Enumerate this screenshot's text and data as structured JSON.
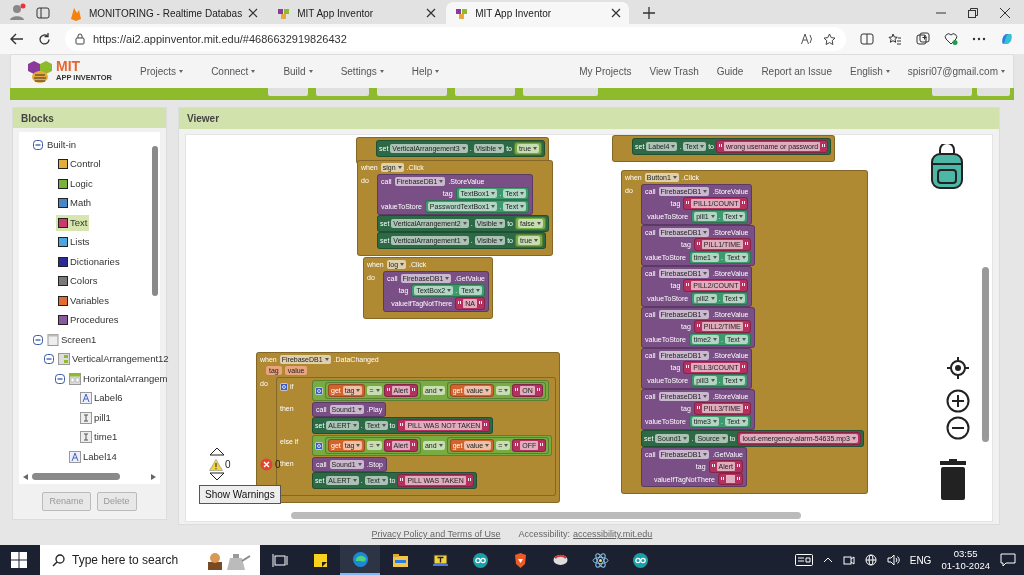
{
  "browser": {
    "tabs": [
      {
        "title": "MONITORING - Realtime Databas",
        "kind": "firebase",
        "selected": false
      },
      {
        "title": "MIT App Inventor",
        "kind": "appinventor",
        "selected": false
      },
      {
        "title": "MIT App Inventor",
        "kind": "appinventor",
        "selected": true
      }
    ],
    "url": "https://ai2.appinventor.mit.edu/#4686632919826432"
  },
  "app_header": {
    "logo_title": "MIT",
    "logo_subtitle": "APP INVENTOR",
    "menus": [
      {
        "label": "Projects",
        "dropdown": true
      },
      {
        "label": "Connect",
        "dropdown": true
      },
      {
        "label": "Build",
        "dropdown": true
      },
      {
        "label": "Settings",
        "dropdown": true
      },
      {
        "label": "Help",
        "dropdown": true
      }
    ],
    "right_links": [
      {
        "label": "My Projects",
        "dropdown": false
      },
      {
        "label": "View Trash",
        "dropdown": false
      },
      {
        "label": "Guide",
        "dropdown": false
      },
      {
        "label": "Report an Issue",
        "dropdown": false
      },
      {
        "label": "English",
        "dropdown": true
      },
      {
        "label": "spisri07@gmail.com",
        "dropdown": true
      }
    ]
  },
  "blocks_panel": {
    "title": "Blocks",
    "tree": [
      {
        "label": "Built-in",
        "kind": "folder",
        "expanded": true,
        "selected": false,
        "children": [
          {
            "label": "Control",
            "kind": "category",
            "color": "#e3ad3c",
            "selected": false
          },
          {
            "label": "Logic",
            "kind": "category",
            "color": "#7ab23d",
            "selected": false
          },
          {
            "label": "Math",
            "kind": "category",
            "color": "#4a85c4",
            "selected": false
          },
          {
            "label": "Text",
            "kind": "category",
            "color": "#c83a6b",
            "selected": true
          },
          {
            "label": "Lists",
            "kind": "category",
            "color": "#4aa6df",
            "selected": false
          },
          {
            "label": "Dictionaries",
            "kind": "category",
            "color": "#2b2a96",
            "selected": false
          },
          {
            "label": "Colors",
            "kind": "category",
            "color": "#7a7a7a",
            "selected": false
          },
          {
            "label": "Variables",
            "kind": "category",
            "color": "#e56c2f",
            "selected": false
          },
          {
            "label": "Procedures",
            "kind": "category",
            "color": "#8b5a9b",
            "selected": false
          }
        ]
      },
      {
        "label": "Screen1",
        "kind": "screen",
        "expanded": true,
        "selected": false,
        "children": [
          {
            "label": "VerticalArrangement12",
            "kind": "vertical",
            "expanded": true,
            "selected": false,
            "children": [
              {
                "label": "HorizontalArrangem",
                "kind": "horizontal",
                "expanded": true,
                "selected": false,
                "children": [
                  {
                    "label": "Label6",
                    "kind": "label",
                    "selected": false
                  },
                  {
                    "label": "pill1",
                    "kind": "textbox",
                    "selected": false
                  },
                  {
                    "label": "time1",
                    "kind": "textbox",
                    "selected": false
                  }
                ]
              },
              {
                "label": "Label14",
                "kind": "label",
                "selected": false
              }
            ]
          }
        ]
      }
    ],
    "buttons": [
      {
        "label": "Rename",
        "disabled": true
      },
      {
        "label": "Delete",
        "disabled": true
      }
    ]
  },
  "viewer": {
    "title": "Viewer",
    "warnings": {
      "warning_count": "0",
      "error_count": "0",
      "toggle_label": "Show Warnings"
    },
    "block_groups": [
      {
        "kind": "event",
        "sections": [
          {
            "body": [
              {
                "kind": "set",
                "parts": [
                  {
                    "kind": "word",
                    "text": "set"
                  },
                  {
                    "kind": "field",
                    "text": "VerticalArrangement3"
                  },
                  {
                    "kind": "word",
                    "text": "."
                  },
                  {
                    "kind": "field",
                    "text": "Visible"
                  },
                  {
                    "kind": "word",
                    "text": "to"
                  },
                  {
                    "kind": "logic",
                    "parts": [
                      {
                        "kind": "field",
                        "text": "true"
                      }
                    ]
                  }
                ]
              }
            ]
          }
        ]
      },
      {
        "kind": "event",
        "parts": [
          {
            "kind": "word",
            "text": "when"
          },
          {
            "kind": "field",
            "text": "sign"
          },
          {
            "kind": "word",
            "text": ".Click"
          }
        ],
        "sections": [
          {
            "head": [
              {
                "kind": "word",
                "text": "do"
              }
            ],
            "body": [
              {
                "kind": "call",
                "parts": [
                  {
                    "kind": "word",
                    "text": "call"
                  },
                  {
                    "kind": "field",
                    "text": "FirebaseDB1"
                  },
                  {
                    "kind": "word",
                    "text": ".StoreValue"
                  }
                ],
                "args": [
                  {
                    "label": "tag",
                    "value": {
                      "kind": "getter",
                      "parts": [
                        {
                          "kind": "field",
                          "text": "TextBox1"
                        },
                        {
                          "kind": "word",
                          "text": "."
                        },
                        {
                          "kind": "field",
                          "text": "Text"
                        }
                      ]
                    }
                  },
                  {
                    "label": "valueToStore",
                    "value": {
                      "kind": "getter",
                      "parts": [
                        {
                          "kind": "field",
                          "text": "PasswordTextBox1"
                        },
                        {
                          "kind": "word",
                          "text": "."
                        },
                        {
                          "kind": "field",
                          "text": "Text"
                        }
                      ]
                    }
                  }
                ]
              },
              {
                "kind": "set",
                "parts": [
                  {
                    "kind": "word",
                    "text": "set"
                  },
                  {
                    "kind": "field",
                    "text": "VerticalArrangement2"
                  },
                  {
                    "kind": "word",
                    "text": "."
                  },
                  {
                    "kind": "field",
                    "text": "Visible"
                  },
                  {
                    "kind": "word",
                    "text": "to"
                  },
                  {
                    "kind": "logic",
                    "parts": [
                      {
                        "kind": "field",
                        "text": "false"
                      }
                    ]
                  }
                ]
              },
              {
                "kind": "set",
                "parts": [
                  {
                    "kind": "word",
                    "text": "set"
                  },
                  {
                    "kind": "field",
                    "text": "VerticalArrangement1"
                  },
                  {
                    "kind": "word",
                    "text": "."
                  },
                  {
                    "kind": "field",
                    "text": "Visible"
                  },
                  {
                    "kind": "word",
                    "text": "to"
                  },
                  {
                    "kind": "logic",
                    "parts": [
                      {
                        "kind": "field",
                        "text": "true"
                      }
                    ]
                  }
                ]
              }
            ]
          }
        ]
      },
      {
        "kind": "event",
        "parts": [
          {
            "kind": "word",
            "text": "when"
          },
          {
            "kind": "field",
            "text": "log"
          },
          {
            "kind": "word",
            "text": ".Click"
          }
        ],
        "sections": [
          {
            "head": [
              {
                "kind": "word",
                "text": "do"
              }
            ],
            "body": [
              {
                "kind": "call",
                "parts": [
                  {
                    "kind": "word",
                    "text": "call"
                  },
                  {
                    "kind": "field",
                    "text": "FirebaseDB1"
                  },
                  {
                    "kind": "word",
                    "text": ".GetValue"
                  }
                ],
                "args": [
                  {
                    "label": "tag",
                    "value": {
                      "kind": "getter",
                      "parts": [
                        {
                          "kind": "field",
                          "text": "TextBox2"
                        },
                        {
                          "kind": "word",
                          "text": "."
                        },
                        {
                          "kind": "field",
                          "text": "Text"
                        }
                      ]
                    }
                  },
                  {
                    "label": "valueIfTagNotThere",
                    "value": {
                      "kind": "text",
                      "parts": [
                        {
                          "kind": "input",
                          "text": "NA"
                        }
                      ]
                    }
                  }
                ]
              }
            ]
          }
        ]
      },
      {
        "kind": "event",
        "parts": [
          {
            "kind": "word",
            "text": "when"
          },
          {
            "kind": "field",
            "text": "FirebaseDB1"
          },
          {
            "kind": "word",
            "text": ".DataChanged"
          }
        ],
        "params": [
          "tag",
          "value"
        ],
        "sections": [
          {
            "head": [
              {
                "kind": "word",
                "text": "do"
              }
            ],
            "body": [
              {
                "kind": "control",
                "sections": [
                  {
                    "head": [
                      {
                        "kind": "mutator"
                      },
                      {
                        "kind": "word",
                        "text": "if"
                      }
                    ],
                    "value": {
                      "kind": "logic",
                      "parts": [
                        {
                          "kind": "mutator"
                        },
                        {
                          "kind": "logic",
                          "parts": [
                            {
                              "kind": "variable",
                              "parts": [
                                {
                                  "kind": "word",
                                  "text": "get"
                                },
                                {
                                  "kind": "field",
                                  "text": "tag"
                                }
                              ]
                            },
                            {
                              "kind": "field",
                              "text": "="
                            },
                            {
                              "kind": "text",
                              "parts": [
                                {
                                  "kind": "input",
                                  "text": "Alert"
                                }
                              ]
                            }
                          ]
                        },
                        {
                          "kind": "field",
                          "text": "and"
                        },
                        {
                          "kind": "logic",
                          "parts": [
                            {
                              "kind": "variable",
                              "parts": [
                                {
                                  "kind": "word",
                                  "text": "get"
                                },
                                {
                                  "kind": "field",
                                  "text": "value"
                                }
                              ]
                            },
                            {
                              "kind": "field",
                              "text": "="
                            },
                            {
                              "kind": "text",
                              "parts": [
                                {
                                  "kind": "input",
                                  "text": "ON"
                                }
                              ]
                            }
                          ]
                        }
                      ]
                    }
                  },
                  {
                    "head": [
                      {
                        "kind": "word",
                        "text": "then"
                      }
                    ],
                    "body": [
                      {
                        "kind": "call",
                        "parts": [
                          {
                            "kind": "word",
                            "text": "call"
                          },
                          {
                            "kind": "field",
                            "text": "Sound1"
                          },
                          {
                            "kind": "word",
                            "text": ".Play"
                          }
                        ]
                      },
                      {
                        "kind": "set",
                        "parts": [
                          {
                            "kind": "word",
                            "text": "set"
                          },
                          {
                            "kind": "field",
                            "text": "ALERT"
                          },
                          {
                            "kind": "word",
                            "text": "."
                          },
                          {
                            "kind": "field",
                            "text": "Text"
                          },
                          {
                            "kind": "word",
                            "text": "to"
                          },
                          {
                            "kind": "text",
                            "parts": [
                              {
                                "kind": "input",
                                "text": "PILL WAS NOT TAKEN"
                              }
                            ]
                          }
                        ]
                      }
                    ]
                  },
                  {
                    "head": [
                      {
                        "kind": "word",
                        "text": "else if"
                      }
                    ],
                    "value": {
                      "kind": "logic",
                      "parts": [
                        {
                          "kind": "mutator"
                        },
                        {
                          "kind": "logic",
                          "parts": [
                            {
                              "kind": "variable",
                              "parts": [
                                {
                                  "kind": "word",
                                  "text": "get"
                                },
                                {
                                  "kind": "field",
                                  "text": "tag"
                                }
                              ]
                            },
                            {
                              "kind": "field",
                              "text": "="
                            },
                            {
                              "kind": "text",
                              "parts": [
                                {
                                  "kind": "input",
                                  "text": "Alert"
                                }
                              ]
                            }
                          ]
                        },
                        {
                          "kind": "field",
                          "text": "and"
                        },
                        {
                          "kind": "logic",
                          "parts": [
                            {
                              "kind": "variable",
                              "parts": [
                                {
                                  "kind": "word",
                                  "text": "get"
                                },
                                {
                                  "kind": "field",
                                  "text": "value"
                                }
                              ]
                            },
                            {
                              "kind": "field",
                              "text": "="
                            },
                            {
                              "kind": "text",
                              "parts": [
                                {
                                  "kind": "input",
                                  "text": "OFF"
                                }
                              ]
                            }
                          ]
                        }
                      ]
                    }
                  },
                  {
                    "head": [
                      {
                        "kind": "word",
                        "text": "then"
                      }
                    ],
                    "body": [
                      {
                        "kind": "call",
                        "parts": [
                          {
                            "kind": "word",
                            "text": "call"
                          },
                          {
                            "kind": "field",
                            "text": "Sound1"
                          },
                          {
                            "kind": "word",
                            "text": ".Stop"
                          }
                        ]
                      },
                      {
                        "kind": "set",
                        "parts": [
                          {
                            "kind": "word",
                            "text": "set"
                          },
                          {
                            "kind": "field",
                            "text": "ALERT"
                          },
                          {
                            "kind": "word",
                            "text": "."
                          },
                          {
                            "kind": "field",
                            "text": "Text"
                          },
                          {
                            "kind": "word",
                            "text": "to"
                          },
                          {
                            "kind": "text",
                            "parts": [
                              {
                                "kind": "input",
                                "text": "PILL WAS TAKEN"
                              }
                            ]
                          }
                        ]
                      }
                    ]
                  }
                ]
              }
            ]
          }
        ]
      },
      {
        "kind": "event",
        "sections": [
          {
            "body": [
              {
                "kind": "set",
                "parts": [
                  {
                    "kind": "word",
                    "text": "set"
                  },
                  {
                    "kind": "field",
                    "text": "Label4"
                  },
                  {
                    "kind": "word",
                    "text": "."
                  },
                  {
                    "kind": "field",
                    "text": "Text"
                  },
                  {
                    "kind": "word",
                    "text": "to"
                  },
                  {
                    "kind": "text",
                    "parts": [
                      {
                        "kind": "input",
                        "text": "wrong username or password"
                      }
                    ]
                  }
                ]
              }
            ]
          }
        ]
      },
      {
        "kind": "event",
        "parts": [
          {
            "kind": "word",
            "text": "when"
          },
          {
            "kind": "field",
            "text": "Button1"
          },
          {
            "kind": "word",
            "text": ".Click"
          }
        ],
        "sections": [
          {
            "head": [
              {
                "kind": "word",
                "text": "do"
              }
            ],
            "body": [
              {
                "kind": "call",
                "parts": [
                  {
                    "kind": "word",
                    "text": "call"
                  },
                  {
                    "kind": "field",
                    "text": "FirebaseDB1"
                  },
                  {
                    "kind": "word",
                    "text": ".StoreValue"
                  }
                ],
                "args": [
                  {
                    "label": "tag",
                    "value": {
                      "kind": "text",
                      "parts": [
                        {
                          "kind": "input",
                          "text": "PILL1/COUNT"
                        }
                      ]
                    }
                  },
                  {
                    "label": "valueToStore",
                    "value": {
                      "kind": "getter",
                      "parts": [
                        {
                          "kind": "field",
                          "text": "pill1"
                        },
                        {
                          "kind": "word",
                          "text": "."
                        },
                        {
                          "kind": "field",
                          "text": "Text"
                        }
                      ]
                    }
                  }
                ]
              },
              {
                "kind": "call",
                "parts": [
                  {
                    "kind": "word",
                    "text": "call"
                  },
                  {
                    "kind": "field",
                    "text": "FirebaseDB1"
                  },
                  {
                    "kind": "word",
                    "text": ".StoreValue"
                  }
                ],
                "args": [
                  {
                    "label": "tag",
                    "value": {
                      "kind": "text",
                      "parts": [
                        {
                          "kind": "input",
                          "text": "PILL1/TIME"
                        }
                      ]
                    }
                  },
                  {
                    "label": "valueToStore",
                    "value": {
                      "kind": "getter",
                      "parts": [
                        {
                          "kind": "field",
                          "text": "time1"
                        },
                        {
                          "kind": "word",
                          "text": "."
                        },
                        {
                          "kind": "field",
                          "text": "Text"
                        }
                      ]
                    }
                  }
                ]
              },
              {
                "kind": "call",
                "parts": [
                  {
                    "kind": "word",
                    "text": "call"
                  },
                  {
                    "kind": "field",
                    "text": "FirebaseDB1"
                  },
                  {
                    "kind": "word",
                    "text": ".StoreValue"
                  }
                ],
                "args": [
                  {
                    "label": "tag",
                    "value": {
                      "kind": "text",
                      "parts": [
                        {
                          "kind": "input",
                          "text": "PILL2/COUNT"
                        }
                      ]
                    }
                  },
                  {
                    "label": "valueToStore",
                    "value": {
                      "kind": "getter",
                      "parts": [
                        {
                          "kind": "field",
                          "text": "pill2"
                        },
                        {
                          "kind": "word",
                          "text": "."
                        },
                        {
                          "kind": "field",
                          "text": "Text"
                        }
                      ]
                    }
                  }
                ]
              },
              {
                "kind": "call",
                "parts": [
                  {
                    "kind": "word",
                    "text": "call"
                  },
                  {
                    "kind": "field",
                    "text": "FirebaseDB1"
                  },
                  {
                    "kind": "word",
                    "text": ".StoreValue"
                  }
                ],
                "args": [
                  {
                    "label": "tag",
                    "value": {
                      "kind": "text",
                      "parts": [
                        {
                          "kind": "input",
                          "text": "PILL2/TIME"
                        }
                      ]
                    }
                  },
                  {
                    "label": "valueToStore",
                    "value": {
                      "kind": "getter",
                      "parts": [
                        {
                          "kind": "field",
                          "text": "time2"
                        },
                        {
                          "kind": "word",
                          "text": "."
                        },
                        {
                          "kind": "field",
                          "text": "Text"
                        }
                      ]
                    }
                  }
                ]
              },
              {
                "kind": "call",
                "parts": [
                  {
                    "kind": "word",
                    "text": "call"
                  },
                  {
                    "kind": "field",
                    "text": "FirebaseDB1"
                  },
                  {
                    "kind": "word",
                    "text": ".StoreValue"
                  }
                ],
                "args": [
                  {
                    "label": "tag",
                    "value": {
                      "kind": "text",
                      "parts": [
                        {
                          "kind": "input",
                          "text": "PILL3/COUNT"
                        }
                      ]
                    }
                  },
                  {
                    "label": "valueToStore",
                    "value": {
                      "kind": "getter",
                      "parts": [
                        {
                          "kind": "field",
                          "text": "pill3"
                        },
                        {
                          "kind": "word",
                          "text": "."
                        },
                        {
                          "kind": "field",
                          "text": "Text"
                        }
                      ]
                    }
                  }
                ]
              },
              {
                "kind": "call",
                "parts": [
                  {
                    "kind": "word",
                    "text": "call"
                  },
                  {
                    "kind": "field",
                    "text": "FirebaseDB1"
                  },
                  {
                    "kind": "word",
                    "text": ".StoreValue"
                  }
                ],
                "args": [
                  {
                    "label": "tag",
                    "value": {
                      "kind": "text",
                      "parts": [
                        {
                          "kind": "input",
                          "text": "PILL3/TIME"
                        }
                      ]
                    }
                  },
                  {
                    "label": "valueToStore",
                    "value": {
                      "kind": "getter",
                      "parts": [
                        {
                          "kind": "field",
                          "text": "time3"
                        },
                        {
                          "kind": "word",
                          "text": "."
                        },
                        {
                          "kind": "field",
                          "text": "Text"
                        }
                      ]
                    }
                  }
                ]
              },
              {
                "kind": "set",
                "parts": [
                  {
                    "kind": "word",
                    "text": "set"
                  },
                  {
                    "kind": "field",
                    "text": "Sound1"
                  },
                  {
                    "kind": "word",
                    "text": "."
                  },
                  {
                    "kind": "field",
                    "text": "Source"
                  },
                  {
                    "kind": "word",
                    "text": "to"
                  },
                  {
                    "kind": "asset",
                    "parts": [
                      {
                        "kind": "field",
                        "text": "loud-emergency-alarm-54635.mp3"
                      }
                    ]
                  }
                ]
              },
              {
                "kind": "call",
                "parts": [
                  {
                    "kind": "word",
                    "text": "call"
                  },
                  {
                    "kind": "field",
                    "text": "FirebaseDB1"
                  },
                  {
                    "kind": "word",
                    "text": ".GetValue"
                  }
                ],
                "args": [
                  {
                    "label": "tag",
                    "value": {
                      "kind": "text",
                      "parts": [
                        {
                          "kind": "input",
                          "text": "Alert"
                        }
                      ]
                    }
                  },
                  {
                    "label": "valueIfTagNotThere",
                    "value": {
                      "kind": "text"
                    }
                  }
                ]
              }
            ]
          }
        ]
      }
    ]
  },
  "footer": {
    "privacy_link": "Privacy Policy and Terms of Use",
    "accessibility_label": "Accessibility:",
    "accessibility_link": "accessibility.mit.edu"
  },
  "taskbar": {
    "search_placeholder": "Type here to search",
    "apps": [
      {
        "kind": "task-view",
        "selected": false
      },
      {
        "kind": "sticky-notes",
        "selected": false
      },
      {
        "kind": "edge",
        "selected": true
      },
      {
        "kind": "file-explorer",
        "selected": false
      },
      {
        "kind": "t-app",
        "selected": false
      },
      {
        "kind": "arduino",
        "selected": false
      },
      {
        "kind": "brave",
        "selected": false
      },
      {
        "kind": "snip",
        "selected": false
      },
      {
        "kind": "atom",
        "selected": false
      },
      {
        "kind": "arduino",
        "selected": false
      }
    ],
    "language": "ENG",
    "time": "03:55",
    "date": "01-10-2024"
  }
}
